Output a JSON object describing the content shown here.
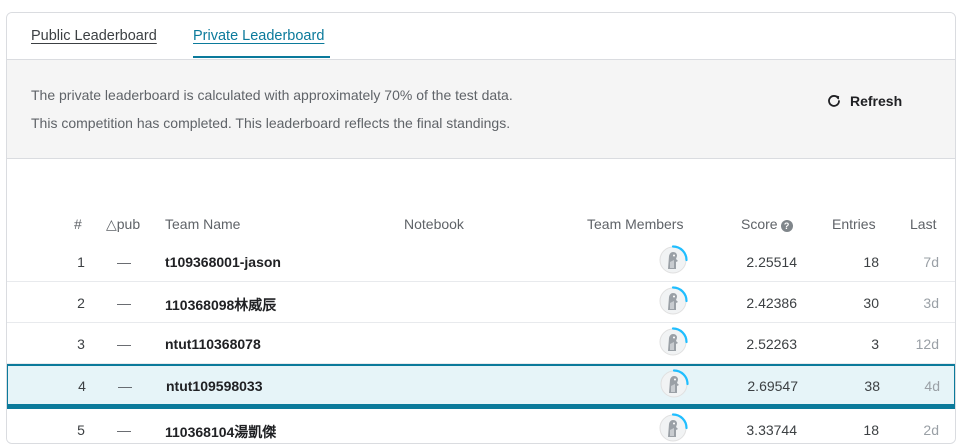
{
  "tabs": [
    {
      "label": "Public Leaderboard",
      "active": false
    },
    {
      "label": "Private Leaderboard",
      "active": true
    }
  ],
  "info": {
    "line1": "The private leaderboard is calculated with approximately 70% of the test data.",
    "line2": "This competition has completed. This leaderboard reflects the final standings.",
    "refresh_label": "Refresh"
  },
  "table": {
    "headers": {
      "rank": "#",
      "delta": "△pub",
      "team": "Team Name",
      "notebook": "Notebook",
      "members": "Team Members",
      "score": "Score",
      "entries": "Entries",
      "last": "Last"
    },
    "rows": [
      {
        "rank": "1",
        "delta": "—",
        "team": "t109368001-jason",
        "score": "2.25514",
        "entries": "18",
        "last": "7d"
      },
      {
        "rank": "2",
        "delta": "—",
        "team": "110368098林威辰",
        "score": "2.42386",
        "entries": "30",
        "last": "3d"
      },
      {
        "rank": "3",
        "delta": "—",
        "team": "ntut110368078",
        "score": "2.52263",
        "entries": "3",
        "last": "12d"
      },
      {
        "rank": "4",
        "delta": "—",
        "team": "ntut109598033",
        "score": "2.69547",
        "entries": "38",
        "last": "4d",
        "highlighted": true
      },
      {
        "rank": "5",
        "delta": "—",
        "team": "110368104湯凱傑",
        "score": "3.33744",
        "entries": "18",
        "last": "2d"
      }
    ]
  },
  "colors": {
    "accent": "#0b7a9b",
    "highlight_bg": "#e6f4f8",
    "progress_ring": "#20beff"
  },
  "icons": {
    "refresh": "refresh-icon",
    "help": "help-circle-icon",
    "avatar": "default-avatar-icon"
  }
}
